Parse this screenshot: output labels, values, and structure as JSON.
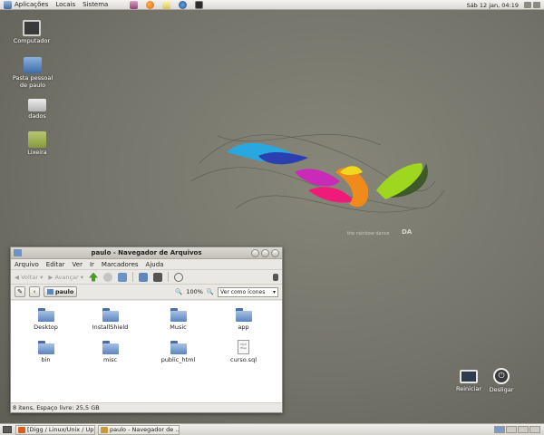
{
  "top_panel": {
    "menus": [
      "Aplicações",
      "Locais",
      "Sistema"
    ],
    "clock": "Sáb 12 jan, 04:19",
    "launcher_icons": [
      "bag-icon",
      "firefox-icon",
      "notes-icon",
      "thunderbird-icon",
      "terminal-icon"
    ]
  },
  "wallpaper": {
    "caption": "the rainbow dance",
    "logo": "DA"
  },
  "desktop_icons": [
    {
      "label": "Computador",
      "icon": "computer-icon"
    },
    {
      "label": "Pasta pessoal de paulo",
      "icon": "home-folder-icon"
    },
    {
      "label": "dados",
      "icon": "drive-icon"
    },
    {
      "label": "Lixeira",
      "icon": "trash-icon"
    }
  ],
  "window": {
    "title": "paulo - Navegador de Arquivos",
    "menu": [
      "Arquivo",
      "Editar",
      "Ver",
      "Ir",
      "Marcadores",
      "Ajuda"
    ],
    "toolbar": {
      "back": "Voltar",
      "forward": "Avançar"
    },
    "location": {
      "crumb": "paulo",
      "zoom": "100%",
      "view": "Ver como ícones"
    },
    "files": [
      {
        "name": "Desktop",
        "type": "folder"
      },
      {
        "name": "InstallShield",
        "type": "folder"
      },
      {
        "name": "Music",
        "type": "folder"
      },
      {
        "name": "app",
        "type": "folder"
      },
      {
        "name": "bin",
        "type": "folder"
      },
      {
        "name": "misc",
        "type": "folder"
      },
      {
        "name": "public_html",
        "type": "folder"
      },
      {
        "name": "curso.sql",
        "type": "document",
        "preview": "Myfi\nfitsp"
      }
    ],
    "status": "8 itens, Espaço livre: 25,5 GB"
  },
  "system_buttons": {
    "restart": "Reiniciar",
    "shutdown": "Desligar"
  },
  "taskbar": {
    "tasks": [
      {
        "label": "[Digg / Linux/Unix / Up...",
        "icon": "firefox-icon"
      },
      {
        "label": "paulo - Navegador de ...",
        "icon": "folder-icon"
      }
    ]
  },
  "colors": {
    "panel": "#dcdad4",
    "folder": "#5a85be",
    "desktop": "#74736a"
  }
}
